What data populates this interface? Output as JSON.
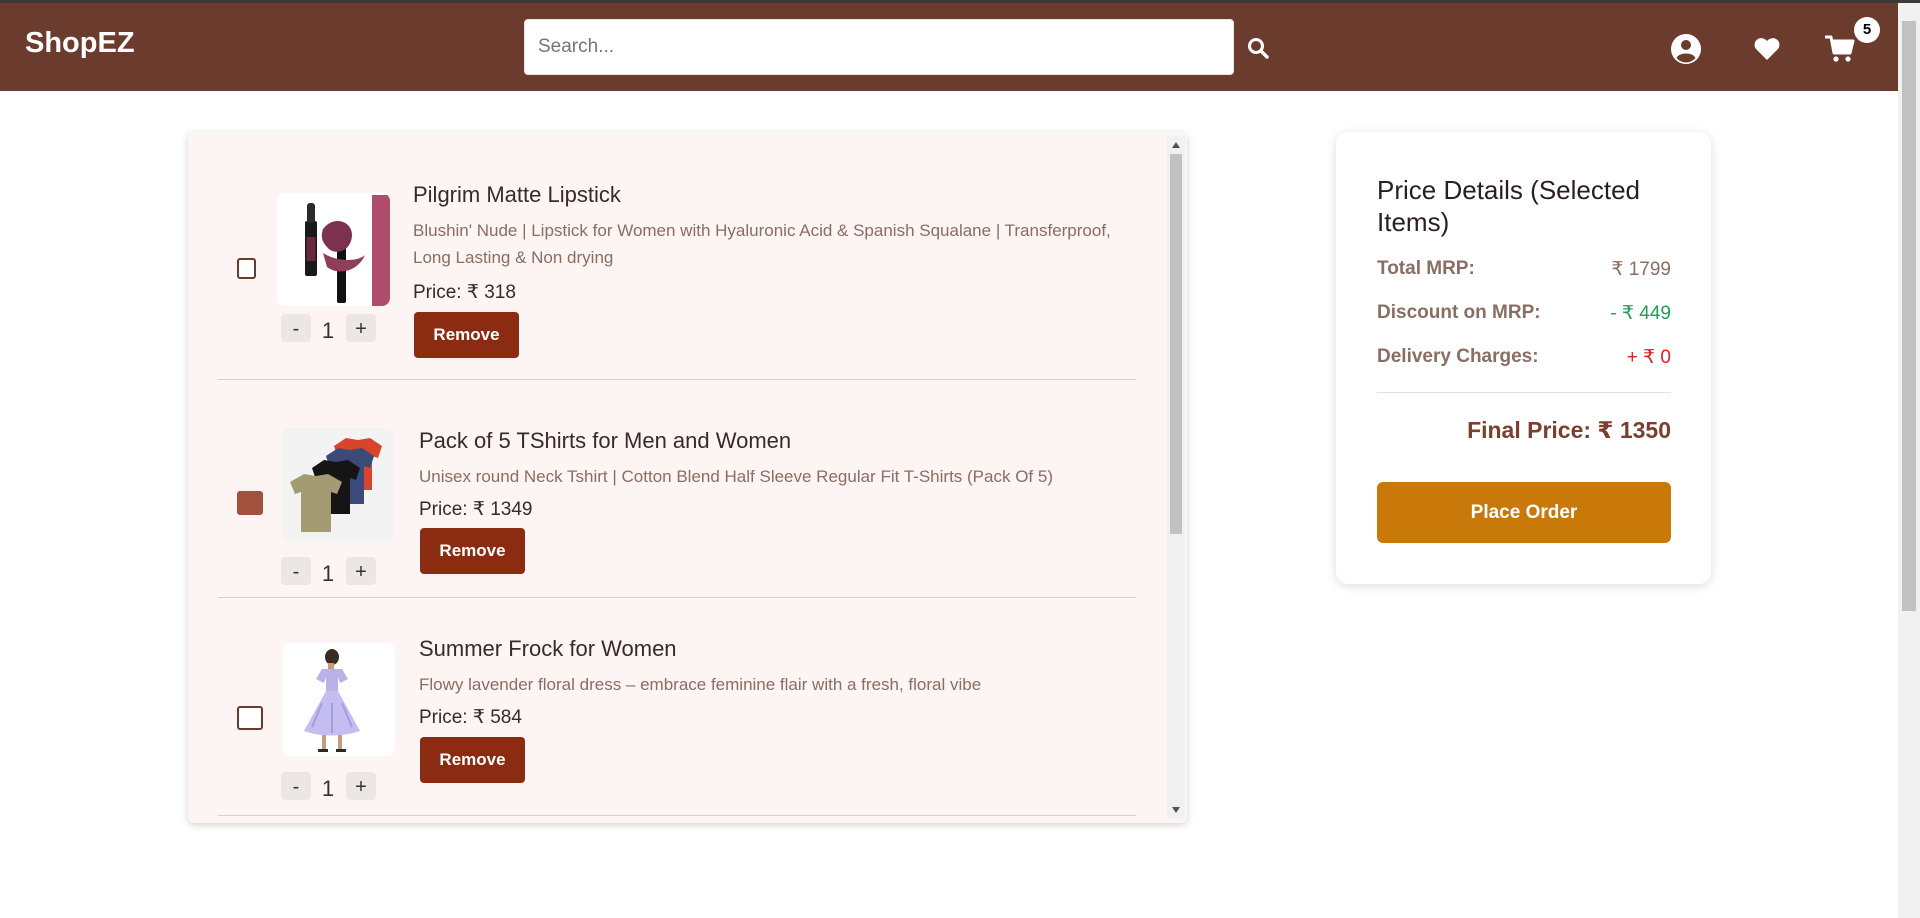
{
  "header": {
    "brand": "ShopEZ",
    "search_placeholder": "Search...",
    "cart_count": "5"
  },
  "icons": {
    "search": "search-icon",
    "profile": "user-circle-icon",
    "wishlist": "heart-icon",
    "cart": "cart-icon"
  },
  "cart": {
    "items": [
      {
        "title": "Pilgrim Matte Lipstick",
        "description": "Blushin' Nude | Lipstick for Women with Hyaluronic Acid & Spanish Squalane | Transferproof, Long Lasting & Non drying",
        "price": "Price: ₹ 318",
        "quantity": "1",
        "checked": false,
        "remove_label": "Remove",
        "minus_label": "-",
        "plus_label": "+"
      },
      {
        "title": "Pack of 5 TShirts for Men and Women",
        "description": "Unisex round Neck Tshirt | Cotton Blend Half Sleeve Regular Fit T-Shirts (Pack Of 5)",
        "price": "Price: ₹ 1349",
        "quantity": "1",
        "checked": true,
        "remove_label": "Remove",
        "minus_label": "-",
        "plus_label": "+"
      },
      {
        "title": "Summer Frock for Women",
        "description": "Flowy lavender floral dress – embrace feminine flair with a fresh, floral vibe",
        "price": "Price: ₹ 584",
        "quantity": "1",
        "checked": false,
        "remove_label": "Remove",
        "minus_label": "-",
        "plus_label": "+"
      }
    ]
  },
  "price_details": {
    "title": "Price Details (Selected Items)",
    "total_mrp_label": "Total MRP:",
    "total_mrp_value": "₹ 1799",
    "discount_label": "Discount on MRP:",
    "discount_value": "- ₹ 449",
    "delivery_label": "Delivery Charges:",
    "delivery_value": "+ ₹ 0",
    "final_price": "Final Price: ₹ 1350",
    "place_order_label": "Place Order"
  },
  "colors": {
    "navbar": "#6b3b2e",
    "remove_button": "#8b2b12",
    "place_order": "#c8790a",
    "discount": "#1f9d55",
    "delivery": "#e02020",
    "checked_box": "#a0523d"
  }
}
